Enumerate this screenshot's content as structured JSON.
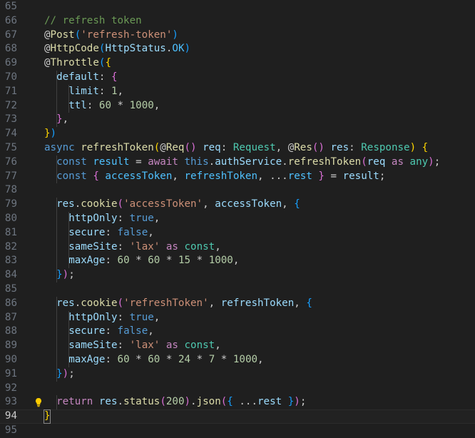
{
  "editor": {
    "current_line": 94,
    "lines": [
      {
        "num": "65",
        "indent": 0,
        "tokens": []
      },
      {
        "num": "66",
        "indent": 1,
        "tokens": [
          [
            "// refresh token",
            "c"
          ]
        ]
      },
      {
        "num": "67",
        "indent": 1,
        "tokens": [
          [
            "@",
            "p"
          ],
          [
            "Post",
            "d"
          ],
          [
            "(",
            "b3"
          ],
          [
            "'refresh-token'",
            "s"
          ],
          [
            ")",
            "b3"
          ]
        ]
      },
      {
        "num": "68",
        "indent": 1,
        "tokens": [
          [
            "@",
            "p"
          ],
          [
            "HttpCode",
            "d"
          ],
          [
            "(",
            "b3"
          ],
          [
            "HttpStatus",
            "v"
          ],
          [
            ".",
            "p"
          ],
          [
            "OK",
            "cn"
          ],
          [
            ")",
            "b3"
          ]
        ]
      },
      {
        "num": "69",
        "indent": 1,
        "tokens": [
          [
            "@",
            "p"
          ],
          [
            "Throttle",
            "d"
          ],
          [
            "(",
            "b3"
          ],
          [
            "{",
            "b1"
          ]
        ]
      },
      {
        "num": "70",
        "indent": 2,
        "tokens": [
          [
            "default",
            "v"
          ],
          [
            ": ",
            "p"
          ],
          [
            "{",
            "b2"
          ]
        ]
      },
      {
        "num": "71",
        "indent": 3,
        "tokens": [
          [
            "limit",
            "v"
          ],
          [
            ": ",
            "p"
          ],
          [
            "1",
            "n"
          ],
          [
            ",",
            "p"
          ]
        ]
      },
      {
        "num": "72",
        "indent": 3,
        "tokens": [
          [
            "ttl",
            "v"
          ],
          [
            ": ",
            "p"
          ],
          [
            "60",
            "n"
          ],
          [
            " * ",
            "p"
          ],
          [
            "1000",
            "n"
          ],
          [
            ",",
            "p"
          ]
        ]
      },
      {
        "num": "73",
        "indent": 2,
        "tokens": [
          [
            "}",
            "b2"
          ],
          [
            ",",
            "p"
          ]
        ]
      },
      {
        "num": "74",
        "indent": 1,
        "tokens": [
          [
            "}",
            "b1"
          ],
          [
            ")",
            "b3"
          ]
        ]
      },
      {
        "num": "75",
        "indent": 1,
        "tokens": [
          [
            "async ",
            "k"
          ],
          [
            "refreshToken",
            "d"
          ],
          [
            "(",
            "b1"
          ],
          [
            "@",
            "p"
          ],
          [
            "Req",
            "d"
          ],
          [
            "()",
            "b2"
          ],
          [
            " req",
            "v"
          ],
          [
            ": ",
            "p"
          ],
          [
            "Request",
            "cls"
          ],
          [
            ", @",
            "p"
          ],
          [
            "Res",
            "d"
          ],
          [
            "()",
            "b2"
          ],
          [
            " res",
            "v"
          ],
          [
            ": ",
            "p"
          ],
          [
            "Response",
            "cls"
          ],
          [
            ")",
            "b1"
          ],
          [
            " ",
            "p"
          ],
          [
            "{",
            "b1"
          ]
        ]
      },
      {
        "num": "76",
        "indent": 2,
        "tokens": [
          [
            "const ",
            "k"
          ],
          [
            "result",
            "cn"
          ],
          [
            " = ",
            "p"
          ],
          [
            "await ",
            "ctl"
          ],
          [
            "this",
            "k"
          ],
          [
            ".",
            "p"
          ],
          [
            "authService",
            "v"
          ],
          [
            ".",
            "p"
          ],
          [
            "refreshToken",
            "d"
          ],
          [
            "(",
            "b2"
          ],
          [
            "req",
            "v"
          ],
          [
            " as ",
            "ctl"
          ],
          [
            "any",
            "cls"
          ],
          [
            ")",
            "b2"
          ],
          [
            ";",
            "p"
          ]
        ]
      },
      {
        "num": "77",
        "indent": 2,
        "tokens": [
          [
            "const ",
            "k"
          ],
          [
            "{",
            "b2"
          ],
          [
            " accessToken",
            "cn"
          ],
          [
            ", ",
            "p"
          ],
          [
            "refreshToken",
            "cn"
          ],
          [
            ", ...",
            "p"
          ],
          [
            "rest",
            "cn"
          ],
          [
            " ",
            "p"
          ],
          [
            "}",
            "b2"
          ],
          [
            " = ",
            "p"
          ],
          [
            "result",
            "v"
          ],
          [
            ";",
            "p"
          ]
        ]
      },
      {
        "num": "78",
        "indent": 0,
        "tokens": []
      },
      {
        "num": "79",
        "indent": 2,
        "tokens": [
          [
            "res",
            "v"
          ],
          [
            ".",
            "p"
          ],
          [
            "cookie",
            "d"
          ],
          [
            "(",
            "b2"
          ],
          [
            "'accessToken'",
            "s"
          ],
          [
            ", ",
            "p"
          ],
          [
            "accessToken",
            "v"
          ],
          [
            ", ",
            "p"
          ],
          [
            "{",
            "b3"
          ]
        ]
      },
      {
        "num": "80",
        "indent": 3,
        "tokens": [
          [
            "httpOnly",
            "v"
          ],
          [
            ": ",
            "p"
          ],
          [
            "true",
            "k"
          ],
          [
            ",",
            "p"
          ]
        ]
      },
      {
        "num": "81",
        "indent": 3,
        "tokens": [
          [
            "secure",
            "v"
          ],
          [
            ": ",
            "p"
          ],
          [
            "false",
            "k"
          ],
          [
            ",",
            "p"
          ]
        ]
      },
      {
        "num": "82",
        "indent": 3,
        "tokens": [
          [
            "sameSite",
            "v"
          ],
          [
            ": ",
            "p"
          ],
          [
            "'lax'",
            "s"
          ],
          [
            " as ",
            "ctl"
          ],
          [
            "const",
            "cls"
          ],
          [
            ",",
            "p"
          ]
        ]
      },
      {
        "num": "83",
        "indent": 3,
        "tokens": [
          [
            "maxAge",
            "v"
          ],
          [
            ": ",
            "p"
          ],
          [
            "60",
            "n"
          ],
          [
            " * ",
            "p"
          ],
          [
            "60",
            "n"
          ],
          [
            " * ",
            "p"
          ],
          [
            "15",
            "n"
          ],
          [
            " * ",
            "p"
          ],
          [
            "1000",
            "n"
          ],
          [
            ",",
            "p"
          ]
        ]
      },
      {
        "num": "84",
        "indent": 2,
        "tokens": [
          [
            "}",
            "b3"
          ],
          [
            ")",
            "b2"
          ],
          [
            ";",
            "p"
          ]
        ]
      },
      {
        "num": "85",
        "indent": 0,
        "tokens": []
      },
      {
        "num": "86",
        "indent": 2,
        "tokens": [
          [
            "res",
            "v"
          ],
          [
            ".",
            "p"
          ],
          [
            "cookie",
            "d"
          ],
          [
            "(",
            "b2"
          ],
          [
            "'refreshToken'",
            "s"
          ],
          [
            ", ",
            "p"
          ],
          [
            "refreshToken",
            "v"
          ],
          [
            ", ",
            "p"
          ],
          [
            "{",
            "b3"
          ]
        ]
      },
      {
        "num": "87",
        "indent": 3,
        "tokens": [
          [
            "httpOnly",
            "v"
          ],
          [
            ": ",
            "p"
          ],
          [
            "true",
            "k"
          ],
          [
            ",",
            "p"
          ]
        ]
      },
      {
        "num": "88",
        "indent": 3,
        "tokens": [
          [
            "secure",
            "v"
          ],
          [
            ": ",
            "p"
          ],
          [
            "false",
            "k"
          ],
          [
            ",",
            "p"
          ]
        ]
      },
      {
        "num": "89",
        "indent": 3,
        "tokens": [
          [
            "sameSite",
            "v"
          ],
          [
            ": ",
            "p"
          ],
          [
            "'lax'",
            "s"
          ],
          [
            " as ",
            "ctl"
          ],
          [
            "const",
            "cls"
          ],
          [
            ",",
            "p"
          ]
        ]
      },
      {
        "num": "90",
        "indent": 3,
        "tokens": [
          [
            "maxAge",
            "v"
          ],
          [
            ": ",
            "p"
          ],
          [
            "60",
            "n"
          ],
          [
            " * ",
            "p"
          ],
          [
            "60",
            "n"
          ],
          [
            " * ",
            "p"
          ],
          [
            "24",
            "n"
          ],
          [
            " * ",
            "p"
          ],
          [
            "7",
            "n"
          ],
          [
            " * ",
            "p"
          ],
          [
            "1000",
            "n"
          ],
          [
            ",",
            "p"
          ]
        ]
      },
      {
        "num": "91",
        "indent": 2,
        "tokens": [
          [
            "}",
            "b3"
          ],
          [
            ")",
            "b2"
          ],
          [
            ";",
            "p"
          ]
        ]
      },
      {
        "num": "92",
        "indent": 0,
        "tokens": []
      },
      {
        "num": "93",
        "indent": 2,
        "tokens": [
          [
            "return ",
            "ctl"
          ],
          [
            "res",
            "v"
          ],
          [
            ".",
            "p"
          ],
          [
            "status",
            "d"
          ],
          [
            "(",
            "b2"
          ],
          [
            "200",
            "n"
          ],
          [
            ")",
            "b2"
          ],
          [
            ".",
            "p"
          ],
          [
            "json",
            "d"
          ],
          [
            "(",
            "b2"
          ],
          [
            "{",
            "b3"
          ],
          [
            " ...",
            "p"
          ],
          [
            "rest",
            "v"
          ],
          [
            " ",
            "p"
          ],
          [
            "}",
            "b3"
          ],
          [
            ")",
            "b2"
          ],
          [
            ";",
            "p"
          ]
        ]
      },
      {
        "num": "94",
        "indent": 1,
        "tokens": [
          [
            "}",
            "b1"
          ]
        ]
      },
      {
        "num": "95",
        "indent": 0,
        "tokens": []
      }
    ],
    "lightbulb_line": 93,
    "colors": {
      "background": "#1f1f1f",
      "comment": "#6a9955",
      "function": "#dcdcaa",
      "string": "#ce9178",
      "number": "#b5cea8",
      "keyword": "#569cd6",
      "control": "#c586c0",
      "variable": "#9cdcfe",
      "type": "#4ec9b0",
      "lightbulb": "#ffcc00"
    }
  }
}
